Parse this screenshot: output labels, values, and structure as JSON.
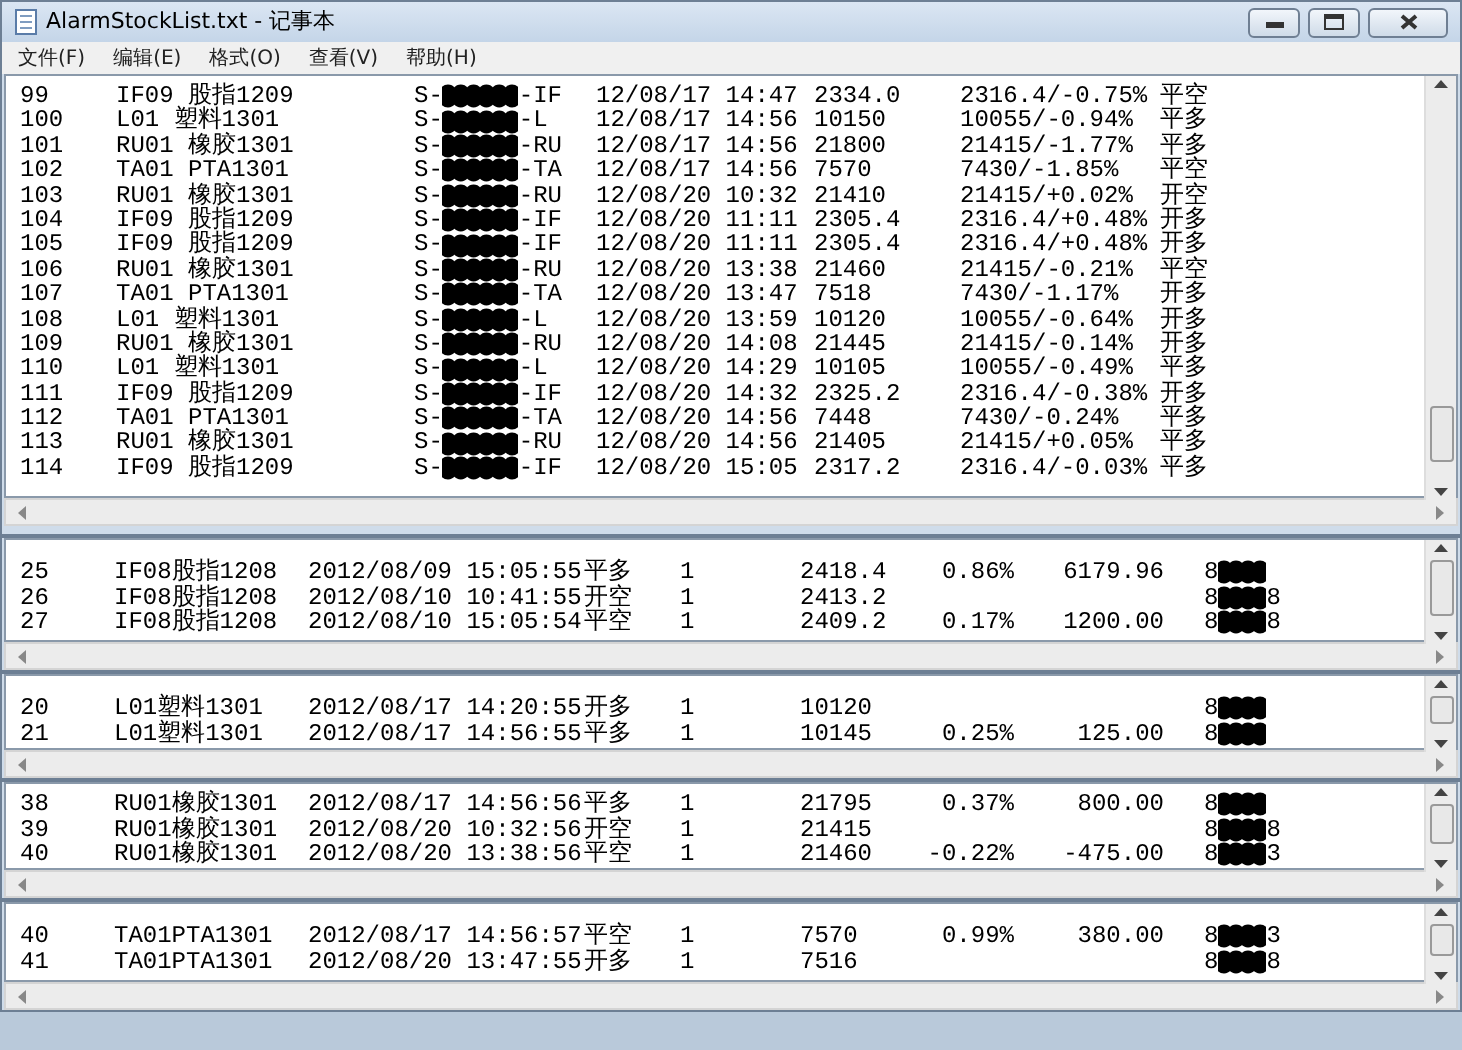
{
  "window": {
    "title": "AlarmStockList.txt - 记事本",
    "menu": [
      "文件(F)",
      "编辑(E)",
      "格式(O)",
      "查看(V)",
      "帮助(H)"
    ]
  },
  "alarm_rows": [
    {
      "number": "99",
      "contract": "IF09 股指1209",
      "code_prefix": "S-",
      "code_suffix": "-IF",
      "time": "12/08/17 14:47",
      "price": "2334.0",
      "reference": "2316.4/-0.75%",
      "signal": "平空"
    },
    {
      "number": "100",
      "contract": "L01 塑料1301",
      "code_prefix": "S-",
      "code_suffix": "-L",
      "time": "12/08/17 14:56",
      "price": "10150",
      "reference": "10055/-0.94%",
      "signal": "平多"
    },
    {
      "number": "101",
      "contract": "RU01 橡胶1301",
      "code_prefix": "S-",
      "code_suffix": "-RU",
      "time": "12/08/17 14:56",
      "price": "21800",
      "reference": "21415/-1.77%",
      "signal": "平多"
    },
    {
      "number": "102",
      "contract": "TA01 PTA1301",
      "code_prefix": "S-",
      "code_suffix": "-TA",
      "time": "12/08/17 14:56",
      "price": "7570",
      "reference": "7430/-1.85%",
      "signal": "平空"
    },
    {
      "number": "103",
      "contract": "RU01 橡胶1301",
      "code_prefix": "S-",
      "code_suffix": "-RU",
      "time": "12/08/20 10:32",
      "price": "21410",
      "reference": "21415/+0.02%",
      "signal": "开空"
    },
    {
      "number": "104",
      "contract": "IF09 股指1209",
      "code_prefix": "S-",
      "code_suffix": "-IF",
      "time": "12/08/20 11:11",
      "price": "2305.4",
      "reference": "2316.4/+0.48%",
      "signal": "开多"
    },
    {
      "number": "105",
      "contract": "IF09 股指1209",
      "code_prefix": "S-",
      "code_suffix": "-IF",
      "time": "12/08/20 11:11",
      "price": "2305.4",
      "reference": "2316.4/+0.48%",
      "signal": "开多"
    },
    {
      "number": "106",
      "contract": "RU01 橡胶1301",
      "code_prefix": "S-",
      "code_suffix": "-RU",
      "time": "12/08/20 13:38",
      "price": "21460",
      "reference": "21415/-0.21%",
      "signal": "平空"
    },
    {
      "number": "107",
      "contract": "TA01 PTA1301",
      "code_prefix": "S-",
      "code_suffix": "-TA",
      "time": "12/08/20 13:47",
      "price": "7518",
      "reference": "7430/-1.17%",
      "signal": "开多"
    },
    {
      "number": "108",
      "contract": "L01 塑料1301",
      "code_prefix": "S-",
      "code_suffix": "-L",
      "time": "12/08/20 13:59",
      "price": "10120",
      "reference": "10055/-0.64%",
      "signal": "开多"
    },
    {
      "number": "109",
      "contract": "RU01 橡胶1301",
      "code_prefix": "S-",
      "code_suffix": "-RU",
      "time": "12/08/20 14:08",
      "price": "21445",
      "reference": "21415/-0.14%",
      "signal": "开多"
    },
    {
      "number": "110",
      "contract": "L01 塑料1301",
      "code_prefix": "S-",
      "code_suffix": "-L",
      "time": "12/08/20 14:29",
      "price": "10105",
      "reference": "10055/-0.49%",
      "signal": "平多"
    },
    {
      "number": "111",
      "contract": "IF09 股指1209",
      "code_prefix": "S-",
      "code_suffix": "-IF",
      "time": "12/08/20 14:32",
      "price": "2325.2",
      "reference": "2316.4/-0.38%",
      "signal": "开多"
    },
    {
      "number": "112",
      "contract": "TA01 PTA1301",
      "code_prefix": "S-",
      "code_suffix": "-TA",
      "time": "12/08/20 14:56",
      "price": "7448",
      "reference": "7430/-0.24%",
      "signal": "平多"
    },
    {
      "number": "113",
      "contract": "RU01 橡胶1301",
      "code_prefix": "S-",
      "code_suffix": "-RU",
      "time": "12/08/20 14:56",
      "price": "21405",
      "reference": "21415/+0.05%",
      "signal": "平多"
    },
    {
      "number": "114",
      "contract": "IF09 股指1209",
      "code_prefix": "S-",
      "code_suffix": "-IF",
      "time": "12/08/20 15:05",
      "price": "2317.2",
      "reference": "2316.4/-0.03%",
      "signal": "平多"
    }
  ],
  "trade_panes": [
    {
      "rows": [
        {
          "number": "25",
          "contract": "IF08股指1208",
          "datetime": "2012/08/09 15:05:55",
          "action": "平多",
          "quantity": "1",
          "price": "2418.4",
          "change": "0.86%",
          "profit": "6179.96",
          "account_prefix": "8"
        },
        {
          "number": "26",
          "contract": "IF08股指1208",
          "datetime": "2012/08/10 10:41:55",
          "action": "开空",
          "quantity": "1",
          "price": "2413.2",
          "account_prefix": "8",
          "account_suffix": "8"
        },
        {
          "number": "27",
          "contract": "IF08股指1208",
          "datetime": "2012/08/10 15:05:54",
          "action": "平空",
          "quantity": "1",
          "price": "2409.2",
          "change": "0.17%",
          "profit": "1200.00",
          "account_prefix": "8",
          "account_suffix": "8"
        }
      ]
    },
    {
      "rows": [
        {
          "number": "20",
          "contract": "L01塑料1301",
          "datetime": "2012/08/17 14:20:55",
          "action": "开多",
          "quantity": "1",
          "price": "10120",
          "account_prefix": "8"
        },
        {
          "number": "21",
          "contract": "L01塑料1301",
          "datetime": "2012/08/17 14:56:55",
          "action": "平多",
          "quantity": "1",
          "price": "10145",
          "change": "0.25%",
          "profit": "125.00",
          "account_prefix": "8"
        }
      ]
    },
    {
      "rows": [
        {
          "number": "38",
          "contract": "RU01橡胶1301",
          "datetime": "2012/08/17 14:56:56",
          "action": "平多",
          "quantity": "1",
          "price": "21795",
          "change": "0.37%",
          "profit": "800.00",
          "account_prefix": "8"
        },
        {
          "number": "39",
          "contract": "RU01橡胶1301",
          "datetime": "2012/08/20 10:32:56",
          "action": "开空",
          "quantity": "1",
          "price": "21415",
          "account_prefix": "8",
          "account_suffix": "8"
        },
        {
          "number": "40",
          "contract": "RU01橡胶1301",
          "datetime": "2012/08/20 13:38:56",
          "action": "平空",
          "quantity": "1",
          "price": "21460",
          "change": "-0.22%",
          "profit": "-475.00",
          "account_prefix": "8",
          "account_suffix": "3"
        }
      ]
    },
    {
      "rows": [
        {
          "number": "40",
          "contract": "TA01PTA1301",
          "datetime": "2012/08/17 14:56:57",
          "action": "平空",
          "quantity": "1",
          "price": "7570",
          "change": "0.99%",
          "profit": "380.00",
          "account_prefix": "8",
          "account_suffix": "3"
        },
        {
          "number": "41",
          "contract": "TA01PTA1301",
          "datetime": "2012/08/20 13:47:55",
          "action": "开多",
          "quantity": "1",
          "price": "7516",
          "account_prefix": "8",
          "account_suffix": "8"
        }
      ]
    }
  ]
}
